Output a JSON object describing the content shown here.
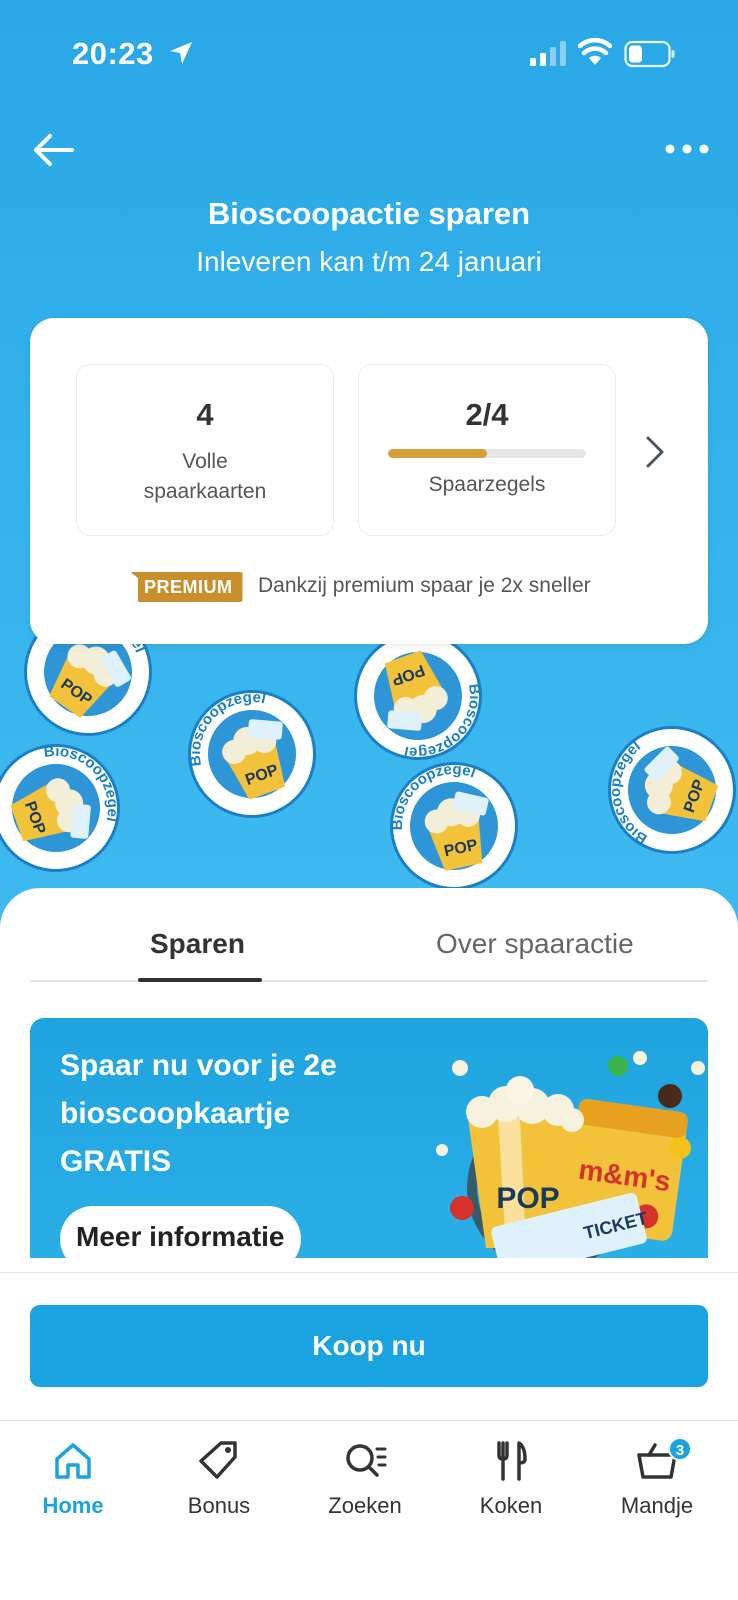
{
  "status_bar": {
    "time": "20:23"
  },
  "header": {
    "title": "Bioscoopactie sparen",
    "subtitle": "Inleveren kan t/m 24 januari"
  },
  "summary": {
    "full_cards_value": "4",
    "full_cards_label_line1": "Volle",
    "full_cards_label_line2": "spaarkaarten",
    "stamps_value": "2/4",
    "stamps_label": "Spaarzegels",
    "stamps_progress": 0.5,
    "premium_badge": "PREMIUM",
    "premium_text": "Dankzij premium spaar je 2x sneller"
  },
  "stickers": {
    "text": "Bioscoopzegel",
    "pop_text": "POP",
    "ticket_text": "TICKET"
  },
  "tabs": [
    {
      "label": "Sparen",
      "active": true
    },
    {
      "label": "Over spaaractie",
      "active": false
    }
  ],
  "promo": {
    "line1": "Spaar nu voor je 2e",
    "line2": "bioscoopkaartje",
    "line3": "GRATIS",
    "button_label": "Meer informatie",
    "pop_text": "POP",
    "ticket_text": "TICKET",
    "mms_text": "m&m's"
  },
  "buy_button_label": "Koop nu",
  "nav": [
    {
      "label": "Home",
      "icon": "home-icon",
      "active": true
    },
    {
      "label": "Bonus",
      "icon": "tag-icon",
      "active": false
    },
    {
      "label": "Zoeken",
      "icon": "search-list-icon",
      "active": false
    },
    {
      "label": "Koken",
      "icon": "cutlery-icon",
      "active": false
    },
    {
      "label": "Mandje",
      "icon": "basket-icon",
      "active": false,
      "badge": "3"
    }
  ],
  "colors": {
    "hero_blue": "#2aa8e6",
    "brand_blue": "#19a3e0",
    "premium_gold": "#c98f2c",
    "progress_gold": "#d4a03a"
  }
}
